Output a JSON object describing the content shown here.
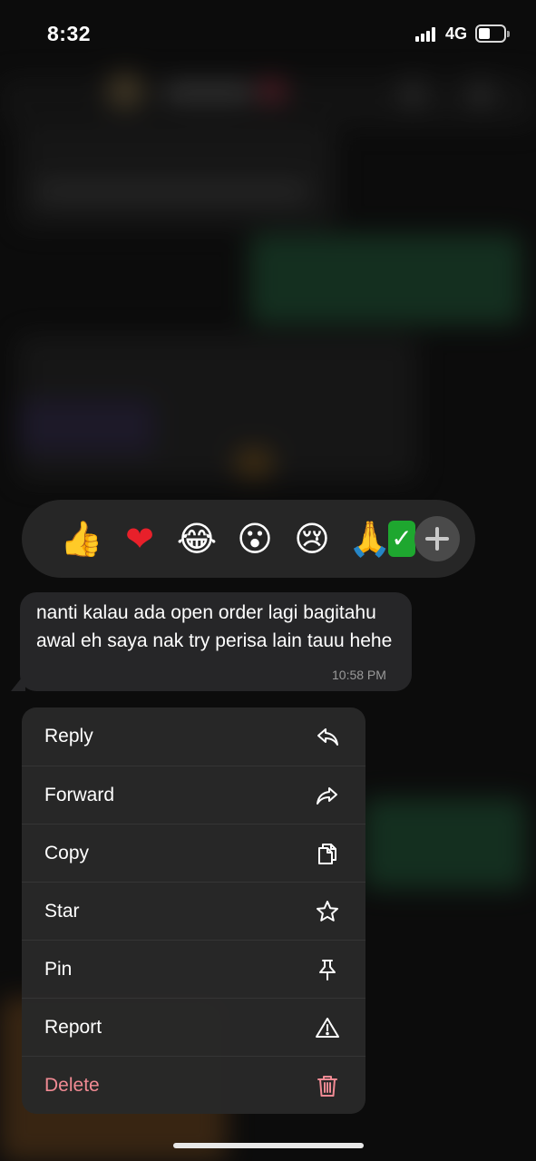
{
  "status_bar": {
    "time": "8:32",
    "network": "4G",
    "battery_level": 0.45
  },
  "reactions": {
    "emojis": [
      {
        "name": "thumbs-up-emoji",
        "glyph": "👍"
      },
      {
        "name": "red-heart-emoji",
        "glyph": "❤"
      },
      {
        "name": "tears-of-joy-emoji",
        "glyph": "😂"
      },
      {
        "name": "surprised-emoji",
        "glyph": "😮"
      },
      {
        "name": "crying-emoji",
        "glyph": "😢"
      },
      {
        "name": "folded-hands-emoji",
        "glyph": "🙏"
      },
      {
        "name": "check-mark-emoji",
        "glyph": "✓"
      }
    ],
    "more_icon": "plus-icon"
  },
  "message": {
    "text": "nanti kalau ada open order lagi bagitahu awal eh saya nak try perisa lain tauu hehe",
    "time": "10:58 PM"
  },
  "menu": {
    "items": [
      {
        "label": "Reply",
        "icon": "reply-icon"
      },
      {
        "label": "Forward",
        "icon": "forward-icon"
      },
      {
        "label": "Copy",
        "icon": "copy-icon"
      },
      {
        "label": "Star",
        "icon": "star-icon"
      },
      {
        "label": "Pin",
        "icon": "pin-icon"
      },
      {
        "label": "Report",
        "icon": "warning-icon"
      },
      {
        "label": "Delete",
        "icon": "trash-icon",
        "color": "#f08a93"
      }
    ]
  },
  "colors": {
    "menu_background": "#282828",
    "bubble_background": "#262628",
    "delete_color": "#f08a93",
    "blurred_outgoing_bubble": "#1f5a37"
  }
}
